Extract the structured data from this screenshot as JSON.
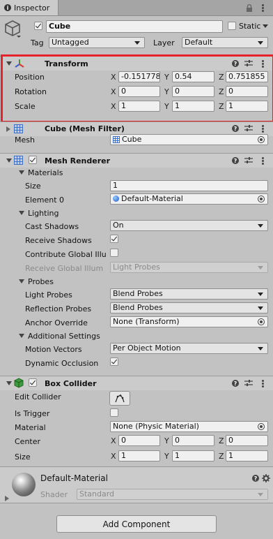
{
  "tab": {
    "title": "Inspector"
  },
  "object": {
    "name": "Cube",
    "static_label": "Static",
    "tag_label": "Tag",
    "tag_value": "Untagged",
    "layer_label": "Layer",
    "layer_value": "Default"
  },
  "transform": {
    "title": "Transform",
    "position_label": "Position",
    "rotation_label": "Rotation",
    "scale_label": "Scale",
    "position": {
      "x": "-0.151778",
      "y": "0.54",
      "z": "0.751855"
    },
    "rotation": {
      "x": "0",
      "y": "0",
      "z": "0"
    },
    "scale": {
      "x": "1",
      "y": "1",
      "z": "1"
    },
    "highlight_color": "#e8222a"
  },
  "axes": {
    "x": "X",
    "y": "Y",
    "z": "Z"
  },
  "mesh_filter": {
    "title": "Cube (Mesh Filter)",
    "mesh_label": "Mesh",
    "mesh_value": "Cube"
  },
  "mesh_renderer": {
    "title": "Mesh Renderer",
    "materials_label": "Materials",
    "size_label": "Size",
    "size_value": "1",
    "element0_label": "Element 0",
    "element0_value": "Default-Material",
    "lighting_label": "Lighting",
    "cast_shadows_label": "Cast Shadows",
    "cast_shadows_value": "On",
    "receive_shadows_label": "Receive Shadows",
    "contribute_gi_label": "Contribute Global Illu",
    "receive_gi_label": "Receive Global Illum",
    "receive_gi_value": "Light Probes",
    "probes_label": "Probes",
    "light_probes_label": "Light Probes",
    "light_probes_value": "Blend Probes",
    "reflection_probes_label": "Reflection Probes",
    "reflection_probes_value": "Blend Probes",
    "anchor_override_label": "Anchor Override",
    "anchor_override_value": "None (Transform)",
    "additional_label": "Additional Settings",
    "motion_vectors_label": "Motion Vectors",
    "motion_vectors_value": "Per Object Motion",
    "dynamic_occlusion_label": "Dynamic Occlusion"
  },
  "box_collider": {
    "title": "Box Collider",
    "edit_collider_label": "Edit Collider",
    "is_trigger_label": "Is Trigger",
    "material_label": "Material",
    "material_value": "None (Physic Material)",
    "center_label": "Center",
    "center": {
      "x": "0",
      "y": "0",
      "z": "0"
    },
    "size_label": "Size",
    "size": {
      "x": "1",
      "y": "1",
      "z": "1"
    }
  },
  "material": {
    "name": "Default-Material",
    "shader_label": "Shader",
    "shader_value": "Standard"
  },
  "add_component_label": "Add Component"
}
